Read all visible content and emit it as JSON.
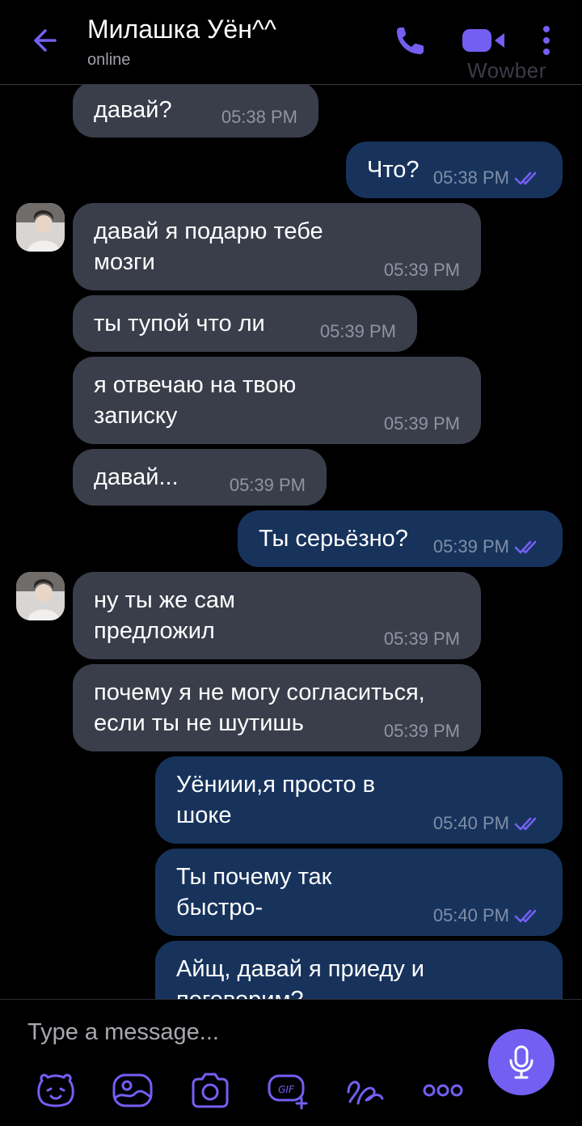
{
  "header": {
    "title": "Милашка Уён^^",
    "status": "online",
    "watermark": "Wowber"
  },
  "colors": {
    "accent": "#7360f2",
    "incoming_bubble": "#3a3e4b",
    "outgoing_bubble": "#17335c",
    "background": "#000000"
  },
  "messages": [
    {
      "dir": "in",
      "text": "давай?",
      "time": "05:38 PM"
    },
    {
      "dir": "out",
      "text": "Что?",
      "time": "05:38 PM",
      "read": true
    },
    {
      "dir": "in",
      "text": "давай я подарю тебе\nмозги",
      "time": "05:39 PM",
      "avatar": true
    },
    {
      "dir": "in",
      "text": "ты тупой что ли",
      "time": "05:39 PM"
    },
    {
      "dir": "in",
      "text": "я отвечаю на твою\nзаписку",
      "time": "05:39 PM"
    },
    {
      "dir": "in",
      "text": "давай...",
      "time": "05:39 PM"
    },
    {
      "dir": "out",
      "text": "Ты серьёзно?",
      "time": "05:39 PM",
      "read": true
    },
    {
      "dir": "in",
      "text": "ну ты же сам\nпредложил",
      "time": "05:39 PM",
      "avatar": true
    },
    {
      "dir": "in",
      "text": "почему я не могу согласиться,\nесли ты не шутишь",
      "time": "05:39 PM"
    },
    {
      "dir": "out",
      "text": "Уёниии,я просто в\nшоке",
      "time": "05:40 PM",
      "read": true
    },
    {
      "dir": "out",
      "text": "Ты почему так\nбыстро-",
      "time": "05:40 PM",
      "read": true
    },
    {
      "dir": "out",
      "text": "Айщ, давай я приеду и\nпоговорим?",
      "time": "",
      "read": false
    }
  ],
  "composer": {
    "placeholder": "Type a message...",
    "tools": [
      "sticker-icon",
      "gallery-icon",
      "camera-icon",
      "gif-icon",
      "doodle-icon",
      "more-options-icon"
    ]
  }
}
